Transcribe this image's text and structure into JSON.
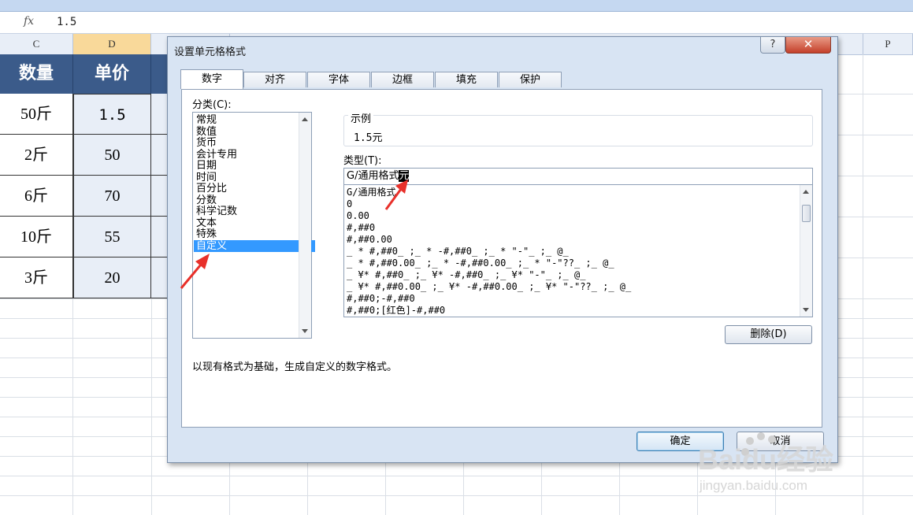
{
  "formula_bar": {
    "fx_label": "fx",
    "value": "1.5"
  },
  "columns": [
    "C",
    "D",
    "",
    "",
    "",
    "",
    "",
    "",
    "",
    "",
    "",
    "",
    "",
    "",
    "",
    "P"
  ],
  "sheet": {
    "headers": [
      "数量",
      "单价"
    ],
    "rows": [
      [
        "50斤",
        "1.5"
      ],
      [
        "2斤",
        "50"
      ],
      [
        "6斤",
        "70"
      ],
      [
        "10斤",
        "55"
      ],
      [
        "3斤",
        "20"
      ]
    ]
  },
  "dialog": {
    "title": "设置单元格格式",
    "help_label": "?",
    "close_label": "✕",
    "tabs": [
      "数字",
      "对齐",
      "字体",
      "边框",
      "填充",
      "保护"
    ],
    "category_label": "分类(C):",
    "categories": [
      "常规",
      "数值",
      "货币",
      "会计专用",
      "日期",
      "时间",
      "百分比",
      "分数",
      "科学记数",
      "文本",
      "特殊",
      "自定义"
    ],
    "selected_category": "自定义",
    "sample_label": "示例",
    "sample_value": "1.5元",
    "type_label": "类型(T):",
    "type_value_prefix": "G/通用格式",
    "type_value_selected": "元",
    "formats": [
      "G/通用格式",
      "0",
      "0.00",
      "#,##0",
      "#,##0.00",
      "_ * #,##0_ ;_ * -#,##0_ ;_ * \"-\"_ ;_ @_",
      "_ * #,##0.00_ ;_ * -#,##0.00_ ;_ * \"-\"??_ ;_ @_",
      "_ ¥* #,##0_ ;_ ¥* -#,##0_ ;_ ¥* \"-\"_ ;_ @_",
      "_ ¥* #,##0.00_ ;_ ¥* -#,##0.00_ ;_ ¥* \"-\"??_ ;_ @_",
      "#,##0;-#,##0",
      "#,##0;[红色]-#,##0"
    ],
    "delete_label": "删除(D)",
    "description": "以现有格式为基础，生成自定义的数字格式。",
    "ok_label": "确定",
    "cancel_label": "取消"
  },
  "watermark": {
    "brand": "Baidu经验",
    "url": "jingyan.baidu.com"
  },
  "colors": {
    "header_fill": "#3b5b8a",
    "selection": "#3399ff",
    "annotation_arrow": "#e8302a"
  }
}
